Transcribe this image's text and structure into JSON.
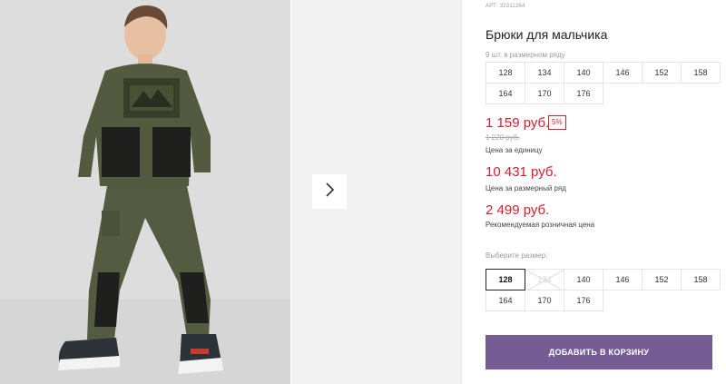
{
  "product": {
    "article": "АРТ: 32311264",
    "title": "Брюки для мальчика",
    "row_hint": "9 шт. в размерном ряду",
    "row_sizes": [
      "128",
      "134",
      "140",
      "146",
      "152",
      "158",
      "164",
      "170",
      "176"
    ]
  },
  "prices": {
    "unit_price": "1 159 руб.",
    "discount_badge": "5%",
    "old_price": "1 220 руб.",
    "unit_caption": "Цена за единицу",
    "row_price": "10 431 руб.",
    "row_caption": "Цена за размерный ряд",
    "retail_price": "2 499 руб.",
    "retail_caption": "Рекомендуемая розничная цена",
    "accent_color": "#d3202f"
  },
  "size_picker": {
    "label": "Выберите размер:",
    "selected": "128",
    "sizes": [
      {
        "label": "128",
        "state": "selected"
      },
      {
        "label": "134",
        "state": "unavailable"
      },
      {
        "label": "140",
        "state": "available"
      },
      {
        "label": "146",
        "state": "available"
      },
      {
        "label": "152",
        "state": "available"
      },
      {
        "label": "158",
        "state": "available"
      },
      {
        "label": "164",
        "state": "available"
      },
      {
        "label": "170",
        "state": "available"
      },
      {
        "label": "176",
        "state": "available"
      }
    ]
  },
  "cart": {
    "button_label": "ДОБАВИТЬ В КОРЗИНУ",
    "button_color": "#765c94"
  },
  "gallery": {
    "next_icon": "chevron-right-icon",
    "photo_subject": "product-photo"
  }
}
